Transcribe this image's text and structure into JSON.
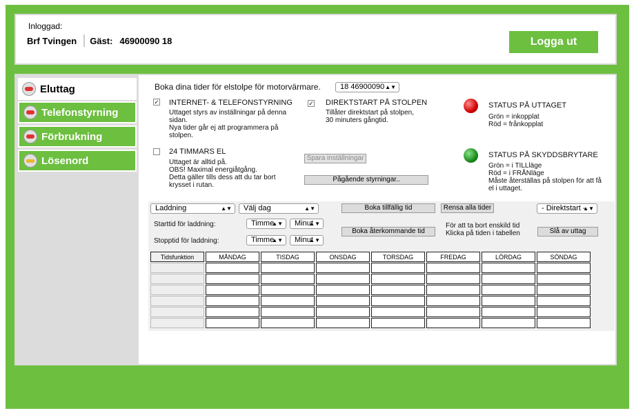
{
  "header": {
    "logged_in_label": "Inloggad:",
    "user_name": "Brf Tvingen",
    "guest_label": "Gäst:",
    "guest_number": "46900090 18",
    "logout_label": "Logga ut"
  },
  "sidebar": {
    "items": [
      {
        "label": "Eluttag",
        "icon": "car-icon",
        "active": true
      },
      {
        "label": "Telefonstyrning",
        "icon": "car-icon",
        "active": false
      },
      {
        "label": "Förbrukning",
        "icon": "car-icon",
        "active": false
      },
      {
        "label": "Lösenord",
        "icon": "key-icon",
        "active": false
      }
    ]
  },
  "booking": {
    "title": "Boka dina tider för elstolpe för motorvärmare.",
    "post_select_value": "18  46900090"
  },
  "options": {
    "internet": {
      "checked": true,
      "title": "INTERNET- & TELEFONSTYRNING",
      "line1": "Uttaget styrs av inställningar på denna",
      "line2": "sidan.",
      "line3": "Nya tider går ej att programmera på",
      "line4": "stolpen."
    },
    "direct": {
      "checked": true,
      "title": "DIREKTSTART PÅ STOLPEN",
      "line1": "Tillåter direktstart på stolpen,",
      "line2": "30 minuters gångtid."
    },
    "always": {
      "checked": false,
      "title": "24 TIMMARS EL",
      "line1": "Uttaget är alltid på.",
      "line2": "OBS! Maximal energiåtgång.",
      "line3": "Detta gäller tills dess att du tar bort",
      "line4": "krysset i rutan."
    },
    "save_label": "Spara inställningar",
    "ongoing_label": "Pågående styrningar.."
  },
  "status": {
    "outlet": {
      "title": "STATUS PÅ UTTAGET",
      "line1": "Grön = inkopplat",
      "line2": "Röd = frånkopplat",
      "color": "#d20000"
    },
    "breaker": {
      "title": "STATUS PÅ SKYDDSBRYTARE",
      "line1": "Grön = i TILLläge",
      "line2": "Röd = i FRÅNläge",
      "line3": "Måste återställas på stolpen för att få",
      "line4": "el i uttaget.",
      "color": "#1a8c1a"
    }
  },
  "controls": {
    "function_select": "Laddning",
    "day_select": "Välj dag",
    "book_temp_label": "Boka tillfällig tid",
    "clear_all_label": "Rensa alla tider",
    "direct_start_select": "- Direktstart -",
    "start_label": "Starttid för laddning:",
    "stop_label": "Stopptid för laddning:",
    "hour_select": "Timme",
    "minute_select": "Minut",
    "book_recurring_label": "Boka återkommande tid",
    "remove_hint1": "För att ta bort enskild tid",
    "remove_hint2": "Klicka på tiden i tabellen",
    "turn_off_label": "Slå av uttag"
  },
  "schedule": {
    "headers": [
      "Tidsfunktion",
      "MÅNDAG",
      "TISDAG",
      "ONSDAG",
      "TORSDAG",
      "FREDAG",
      "LÖRDAG",
      "SÖNDAG"
    ],
    "row_count": 6
  }
}
